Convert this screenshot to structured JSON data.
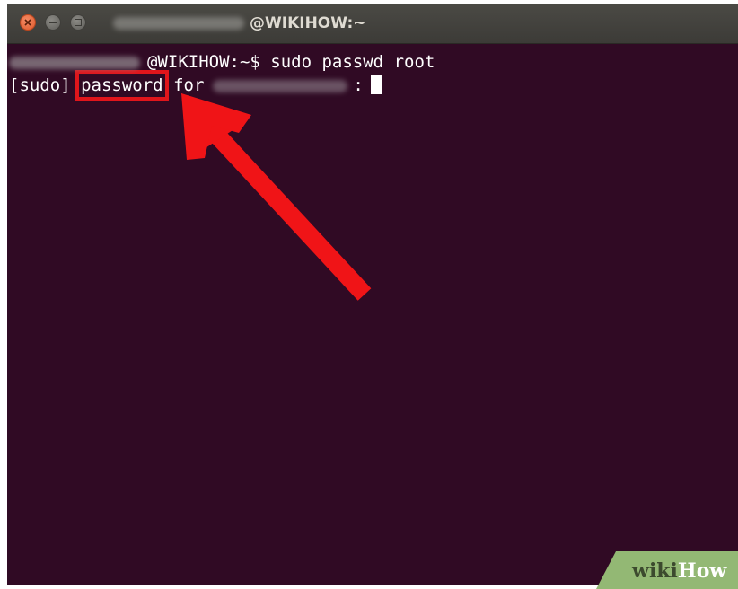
{
  "window": {
    "title": "@WIKIHOW:~",
    "buttons": {
      "close_icon": "close-icon",
      "minimize_icon": "minimize-icon",
      "maximize_icon": "maximize-icon"
    }
  },
  "terminal": {
    "line1": {
      "prompt_host": "@WIKIHOW:~$",
      "command": "sudo passwd root"
    },
    "line2": {
      "prefix": "[sudo]",
      "highlighted_word": "password",
      "for_text": "for",
      "colon": ":"
    }
  },
  "annotation": {
    "highlight_color": "#e0151b",
    "arrow_color": "#f01417"
  },
  "watermark": {
    "wiki": "wiki",
    "how": "How"
  },
  "colors": {
    "terminal_bg": "#300a24",
    "titlebar_bg": "#3c3b37",
    "text": "#ffffff"
  }
}
